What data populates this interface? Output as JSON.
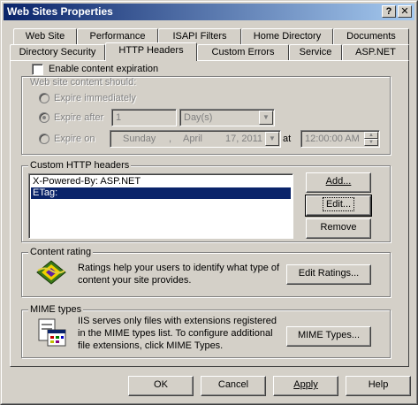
{
  "window": {
    "title": "Web Sites Properties",
    "help_btn": "?",
    "close_btn": "✕"
  },
  "tabs_back": [
    "Web Site",
    "Performance",
    "ISAPI Filters",
    "Home Directory",
    "Documents"
  ],
  "tabs_front": [
    "Directory Security",
    "HTTP Headers",
    "Custom Errors",
    "Service",
    "ASP.NET"
  ],
  "active_tab": "HTTP Headers",
  "expiration": {
    "enable_label": "Enable content expiration",
    "should_label": "Web site content should:",
    "immediately": "Expire immediately",
    "after": "Expire after",
    "after_value": "1",
    "unit": "Day(s)",
    "on": "Expire on",
    "date_weekday": "Sunday",
    "date_sep": ",",
    "date_month": "April",
    "date_day": "17, 2011",
    "at_label": "at",
    "time": "12:00:00 AM"
  },
  "headers": {
    "label": "Custom HTTP headers",
    "items": [
      "X-Powered-By: ASP.NET",
      "ETag:"
    ],
    "add": "Add...",
    "edit": "Edit...",
    "remove": "Remove"
  },
  "rating": {
    "label": "Content rating",
    "text_line1": "Ratings help your users to identify what type of",
    "text_line2": "content your site provides.",
    "button": "Edit Ratings..."
  },
  "mime": {
    "label": "MIME types",
    "text_line1": "IIS serves only files with extensions registered",
    "text_line2": "in the MIME types list. To configure additional",
    "text_line3": "file extensions, click MIME Types.",
    "button": "MIME Types..."
  },
  "footer": {
    "ok": "OK",
    "cancel": "Cancel",
    "apply": "Apply",
    "help": "Help"
  }
}
